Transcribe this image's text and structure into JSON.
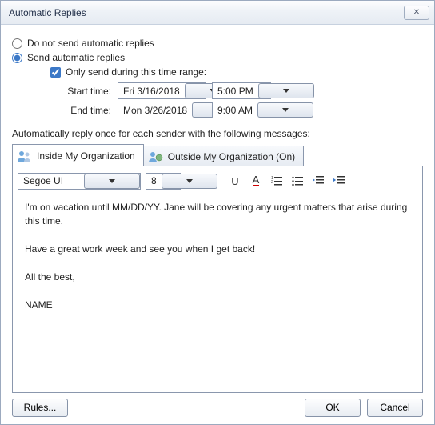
{
  "window": {
    "title": "Automatic Replies"
  },
  "options": {
    "dont_send_label": "Do not send automatic replies",
    "send_label": "Send automatic replies",
    "selected": "send"
  },
  "range": {
    "only_send_label": "Only send during this time range:",
    "only_send_checked": true,
    "start_label": "Start time:",
    "start_date": "Fri 3/16/2018",
    "start_time": "5:00 PM",
    "end_label": "End time:",
    "end_date": "Mon 3/26/2018",
    "end_time": "9:00 AM"
  },
  "autoline": "Automatically reply once for each sender with the following messages:",
  "tabs": {
    "inside": "Inside My Organization",
    "outside": "Outside My Organization (On)",
    "active": "inside"
  },
  "format": {
    "font_name": "Segoe UI",
    "font_size": "8"
  },
  "message": "I'm on vacation until MM/DD/YY. Jane will be covering any urgent matters that arise during this time.\n\nHave a great work week and see you when I get back!\n\nAll the best,\n\nNAME",
  "buttons": {
    "rules": "Rules...",
    "ok": "OK",
    "cancel": "Cancel"
  }
}
